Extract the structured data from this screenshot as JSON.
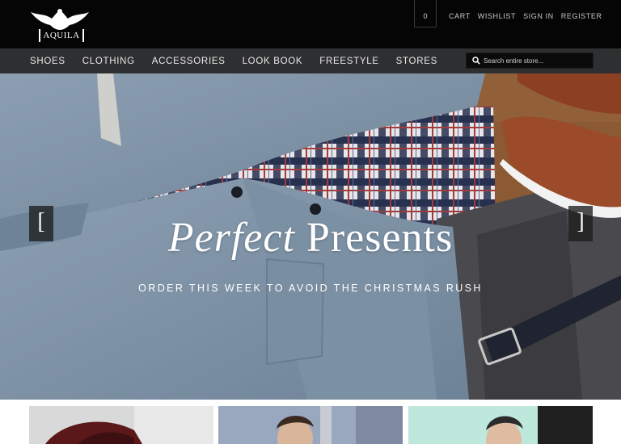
{
  "brand": {
    "name": "AQUILA"
  },
  "header": {
    "cart_count": "0",
    "links": [
      "CART",
      "WISHLIST",
      "SIGN IN",
      "REGISTER"
    ]
  },
  "nav": {
    "items": [
      "SHOES",
      "CLOTHING",
      "ACCESSORIES",
      "LOOK BOOK",
      "FREESTYLE",
      "STORES"
    ]
  },
  "search": {
    "placeholder": "Search entire store..."
  },
  "hero": {
    "title_italic": "Perfect",
    "title_regular": "Presents",
    "subtitle": "ORDER THIS WEEK TO AVOID THE CHRISTMAS RUSH",
    "prev_label": "[",
    "next_label": "]"
  },
  "colors": {
    "topbar": "#050505",
    "navbar": "#2e2f31",
    "jacket": "#7f93a6",
    "wood": "#8a5a33"
  },
  "icons": [
    "eagle-logo-icon",
    "search-icon"
  ]
}
